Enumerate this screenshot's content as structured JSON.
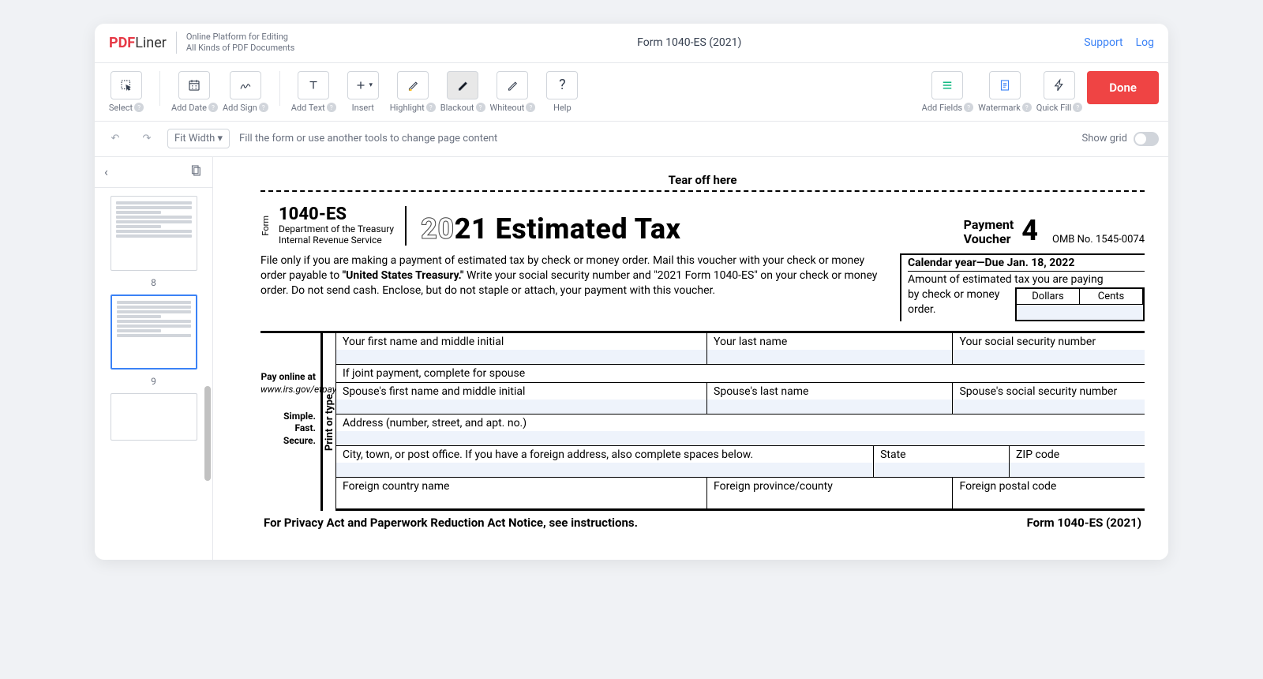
{
  "header": {
    "logo_main": "PDF",
    "logo_sub": "Liner",
    "tagline_line1": "Online Platform for Editing",
    "tagline_line2": "All Kinds of PDF Documents",
    "doc_title": "Form 1040-ES (2021)",
    "link_support": "Support",
    "link_log": "Log"
  },
  "toolbar": {
    "select": "Select",
    "add_date": "Add Date",
    "add_sign": "Add Sign",
    "add_text": "Add Text",
    "insert": "Insert",
    "highlight": "Highlight",
    "blackout": "Blackout",
    "whiteout": "Whiteout",
    "help": "Help",
    "add_fields": "Add Fields",
    "watermark": "Watermark",
    "quick_fill": "Quick Fill",
    "done": "Done"
  },
  "subbar": {
    "zoom": "Fit Width",
    "hint": "Fill the form or use another tools to change page content",
    "show_grid": "Show grid"
  },
  "thumbnails": {
    "page_a": "8",
    "page_b": "9"
  },
  "form": {
    "tear": "Tear off here",
    "form_word": "Form",
    "form_number": "1040-ES",
    "dept1": "Department of the Treasury",
    "dept2": "Internal Revenue Service",
    "year_light": "20",
    "year_bold": "21",
    "title_rest": " Estimated Tax",
    "pv_label1": "Payment",
    "pv_label2": "Voucher",
    "pv_num": "4",
    "omb": "OMB No. 1545-0074",
    "instr_pre": "File only if you are making a payment of estimated tax by check or money order. Mail this voucher with your check or money order payable to ",
    "instr_bold": "\"United States Treasury.\"",
    "instr_post": " Write your social security number and \"2021 Form 1040-ES\" on your check or money order. Do not send cash. Enclose, but do not staple or attach, your payment with this voucher.",
    "calendar_due": "Calendar year—Due Jan. 18, 2022",
    "amount_label": "Amount of estimated tax you are paying",
    "by_check": "by check or money order.",
    "dollars": "Dollars",
    "cents": "Cents",
    "pay_online": "Pay online at",
    "irs_url": "www.irs.gov/etpay",
    "simple": "Simple.",
    "fast": "Fast.",
    "secure": "Secure.",
    "print_type": "Print or type",
    "first_name": "Your first name and middle initial",
    "last_name": "Your last name",
    "ssn": "Your social security number",
    "joint": "If joint payment, complete for spouse",
    "sp_first": "Spouse's first name and middle initial",
    "sp_last": "Spouse's last name",
    "sp_ssn": "Spouse's social security number",
    "address": "Address (number, street, and apt. no.)",
    "city": "City, town, or post office. If you have a foreign address, also complete spaces below.",
    "state": "State",
    "zip": "ZIP code",
    "f_country": "Foreign country name",
    "f_province": "Foreign province/county",
    "f_postal": "Foreign postal code",
    "privacy": "For Privacy Act and Paperwork Reduction Act Notice, see instructions.",
    "footer_right": "Form 1040-ES (2021)"
  }
}
